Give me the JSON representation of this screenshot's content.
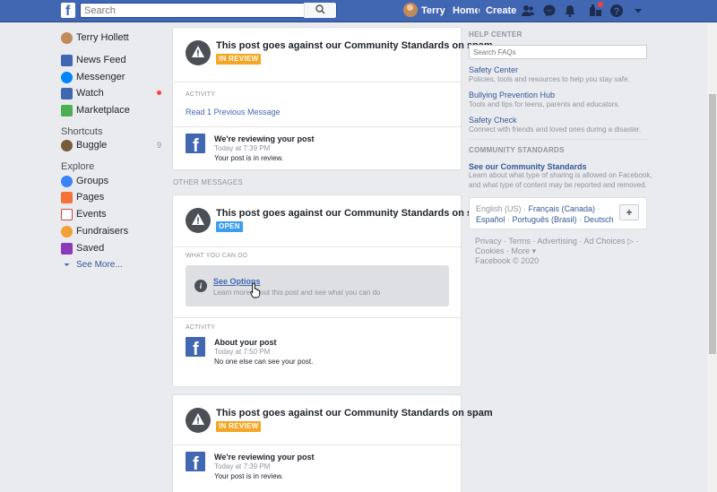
{
  "header": {
    "search_placeholder": "Search",
    "user_name": "Terry",
    "home_label": "Home",
    "create_label": "Create"
  },
  "sidebar": {
    "profile_name": "Terry Hollett",
    "items": [
      {
        "label": "News Feed",
        "icon": "news-feed-icon",
        "color": "#4267b2"
      },
      {
        "label": "Messenger",
        "icon": "messenger-icon",
        "color": "#0084ff"
      },
      {
        "label": "Watch",
        "icon": "watch-icon",
        "color": "#4267b2"
      },
      {
        "label": "Marketplace",
        "icon": "marketplace-icon",
        "color": "#4cb050"
      }
    ],
    "shortcuts_heading": "Shortcuts",
    "shortcut": {
      "label": "Buggle",
      "count": "9"
    },
    "explore_heading": "Explore",
    "explore": [
      {
        "label": "Groups",
        "icon": "groups-icon",
        "color": "#3b82f6"
      },
      {
        "label": "Pages",
        "icon": "pages-icon",
        "color": "#f5733b"
      },
      {
        "label": "Events",
        "icon": "events-icon",
        "color": "#d6423a"
      },
      {
        "label": "Fundraisers",
        "icon": "fundraisers-icon",
        "color": "#f2a033"
      },
      {
        "label": "Saved",
        "icon": "saved-icon",
        "color": "#8a3ab9"
      }
    ],
    "see_more": "See More..."
  },
  "main": {
    "card1": {
      "title": "This post goes against our Community Standards on spam",
      "badge": "IN REVIEW",
      "activity_label": "ACTIVITY",
      "previous_link": "Read 1 Previous Message",
      "activity": {
        "title": "We're reviewing your post",
        "time": "Today at 7:39 PM",
        "body": "Your post is in review."
      }
    },
    "other_messages_label": "OTHER MESSAGES",
    "card2": {
      "title": "This post goes against our Community Standards on spam",
      "badge": "OPEN",
      "what_label": "WHAT YOU CAN DO",
      "options_title": "See Options",
      "options_sub": "Learn more about this post and see what you can do",
      "activity_label": "ACTIVITY",
      "activity": {
        "title": "About your post",
        "time": "Today at 7:50 PM",
        "body": "No one else can see your post."
      }
    },
    "card3": {
      "title": "This post goes against our Community Standards on spam",
      "badge": "IN REVIEW",
      "activity": {
        "title": "We're reviewing your post",
        "time": "Today at 7:39 PM",
        "body": "Your post is in review."
      }
    }
  },
  "right": {
    "help_center_label": "HELP CENTER",
    "faq_placeholder": "Search FAQs",
    "links": [
      {
        "title": "Safety Center",
        "desc": "Policies, tools and resources to help you stay safe."
      },
      {
        "title": "Bullying Prevention Hub",
        "desc": "Tools and tips for teens, parents and educators."
      },
      {
        "title": "Safety Check",
        "desc": "Connect with friends and loved ones during a disaster."
      }
    ],
    "community_label": "COMMUNITY STANDARDS",
    "community_link": "See our Community Standards",
    "community_desc1": "Learn about what type of sharing is allowed on Facebook,",
    "community_desc2": "and what type of content may be reported and removed.",
    "languages": {
      "current": "English (US)",
      "options": [
        "Français (Canada)",
        "Español",
        "Português (Brasil)",
        "Deutsch"
      ],
      "add_label": "+"
    },
    "footer": {
      "line1": [
        "Privacy",
        "Terms",
        "Advertising",
        "Ad Choices ▷"
      ],
      "line2": [
        "Cookies",
        "More"
      ],
      "copyright": "Facebook © 2020"
    }
  }
}
